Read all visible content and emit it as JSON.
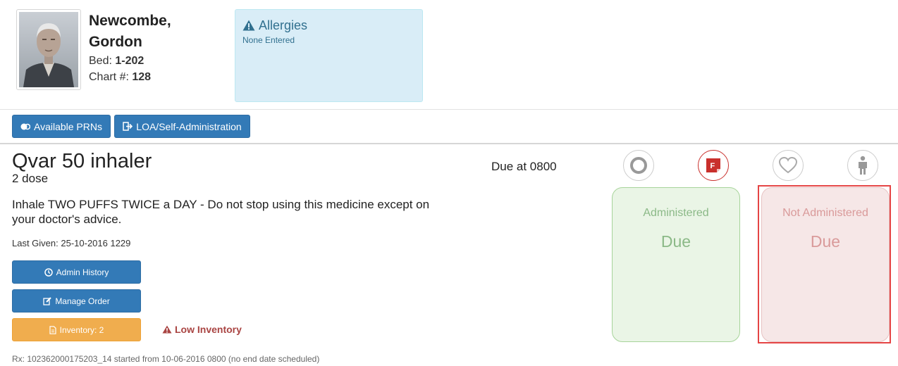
{
  "patient": {
    "name": "Newcombe, Gordon",
    "bed_label": "Bed:",
    "bed_value": "1-202",
    "chart_label": "Chart #:",
    "chart_value": "128"
  },
  "allergies": {
    "title": "Allergies",
    "subtitle": "None Entered",
    "icon": "warning-icon"
  },
  "toolbar": {
    "prn_label": "Available PRNs",
    "loa_label": "LOA/Self-Administration"
  },
  "medication": {
    "name": "Qvar 50 inhaler",
    "dose": "2 dose",
    "instructions": "Inhale TWO PUFFS TWICE a DAY - Do not stop using this medicine except on your doctor's advice.",
    "last_given": "Last Given: 25-10-2016 1229",
    "due": "Due at 0800",
    "rx": "Rx: 102362000175203_14 started from 10-06-2016 0800 (no end date scheduled)"
  },
  "actions": {
    "admin_history": "Admin History",
    "manage_order": "Manage Order",
    "inventory": "Inventory: 2",
    "low_inventory": "Low Inventory"
  },
  "status_icons": [
    "circle-icon",
    "flag-f-icon",
    "heart-icon",
    "person-icon"
  ],
  "cards": {
    "administered_title": "Administered",
    "administered_status": "Due",
    "not_administered_title": "Not Administered",
    "not_administered_status": "Due"
  },
  "colors": {
    "primary_button": "#337ab7",
    "warning_button": "#f0ad4e",
    "allergy_bg": "#d9edf7",
    "danger_text": "#a94442",
    "highlight_border": "#e54545"
  }
}
